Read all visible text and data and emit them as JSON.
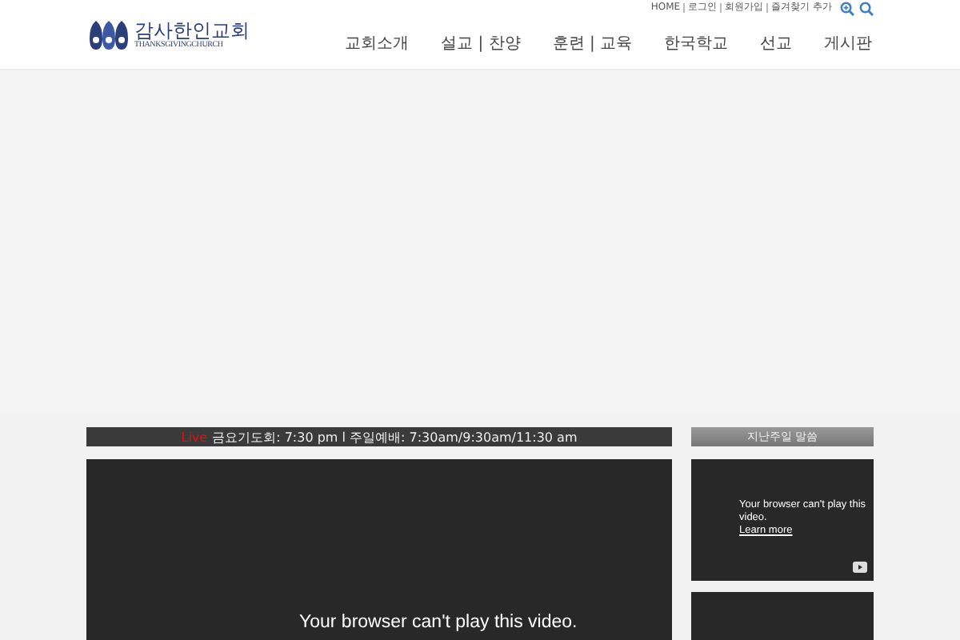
{
  "logo": {
    "name": "감사한인교회",
    "subtitle": "THANKSGIVINGCHURCH"
  },
  "utility_links": [
    "HOME",
    "로그인",
    "회원가입",
    "즐겨찾기 추가"
  ],
  "nav": [
    "교회소개",
    "설교 | 찬양",
    "훈련 | 교육",
    "한국학교",
    "선교",
    "게시판"
  ],
  "service_bar": {
    "badge": "Live",
    "text": "금요기도회: 7:30 pm l 주일예배: 7:30am/9:30am/11:30 am"
  },
  "sidebar": {
    "title": "지난주일 말씀"
  },
  "main_video": {
    "message": "Your browser can't play this video."
  },
  "side_videos": [
    {
      "kind": "video",
      "message": "Your browser can't play this video.",
      "link": "Learn more"
    },
    {
      "kind": "video"
    }
  ]
}
